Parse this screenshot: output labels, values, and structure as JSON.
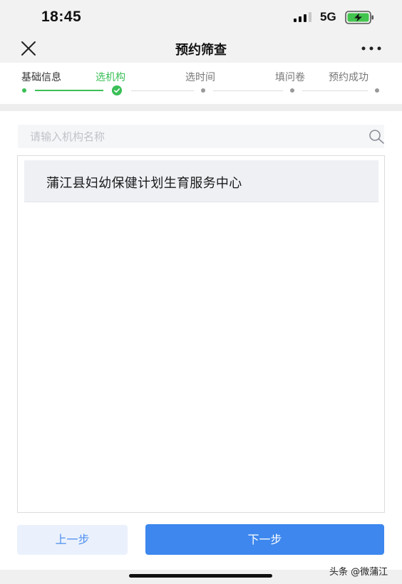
{
  "status_bar": {
    "time": "18:45",
    "network": "5G",
    "icons": [
      "signal-icon",
      "battery-charging-icon"
    ]
  },
  "nav": {
    "title": "预约筛查",
    "icons": [
      "close-icon",
      "more-icon"
    ]
  },
  "steps": [
    {
      "label": "基础信息",
      "state": "done"
    },
    {
      "label": "选机构",
      "state": "active"
    },
    {
      "label": "选时间",
      "state": "pending"
    },
    {
      "label": "填问卷",
      "state": "pending"
    },
    {
      "label": "预约成功",
      "state": "pending"
    }
  ],
  "search": {
    "placeholder": "请输入机构名称",
    "value": "",
    "icon": "search-icon"
  },
  "institutions": [
    {
      "name": "蒲江县妇幼保健计划生育服务中心",
      "selected": true
    }
  ],
  "buttons": {
    "prev": "上一步",
    "next": "下一步"
  },
  "watermark": "头条 @微蒲江",
  "colors": {
    "accent_green": "#3bbf57",
    "primary_blue": "#3d87ee",
    "secondary_blue_text": "#4f8ff0",
    "secondary_blue_bg": "#eaf1fc",
    "selected_item_bg": "#eef0f4"
  }
}
